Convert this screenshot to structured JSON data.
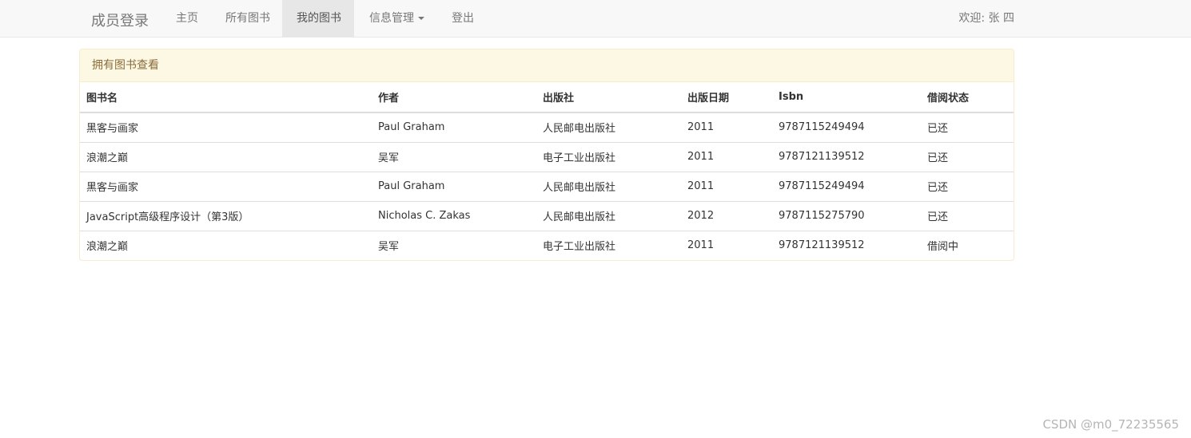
{
  "navbar": {
    "brand": "成员登录",
    "items": [
      {
        "label": "主页",
        "active": false
      },
      {
        "label": "所有图书",
        "active": false
      },
      {
        "label": "我的图书",
        "active": true
      },
      {
        "label": "信息管理",
        "active": false,
        "dropdown": true
      },
      {
        "label": "登出",
        "active": false
      }
    ],
    "welcome": "欢迎: 张 四"
  },
  "panel": {
    "heading": "拥有图书查看",
    "columns": [
      "图书名",
      "作者",
      "出版社",
      "出版日期",
      "Isbn",
      "借阅状态"
    ],
    "rows": [
      [
        "黑客与画家",
        "Paul Graham",
        "人民邮电出版社",
        "2011",
        "9787115249494",
        "已还"
      ],
      [
        "浪潮之巅",
        "吴军",
        "电子工业出版社",
        "2011",
        "9787121139512",
        "已还"
      ],
      [
        "黑客与画家",
        "Paul Graham",
        "人民邮电出版社",
        "2011",
        "9787115249494",
        "已还"
      ],
      [
        "JavaScript高级程序设计（第3版）",
        "Nicholas C. Zakas",
        "人民邮电出版社",
        "2012",
        "9787115275790",
        "已还"
      ],
      [
        "浪潮之巅",
        "吴军",
        "电子工业出版社",
        "2011",
        "9787121139512",
        "借阅中"
      ]
    ]
  },
  "watermark": "CSDN @m0_72235565",
  "colors": {
    "navbar_bg": "#f8f8f8",
    "active_bg": "#e7e7e7",
    "panel_heading_bg": "#fcf8e3",
    "panel_heading_text": "#8a6d3b",
    "panel_border": "#faebcc"
  }
}
